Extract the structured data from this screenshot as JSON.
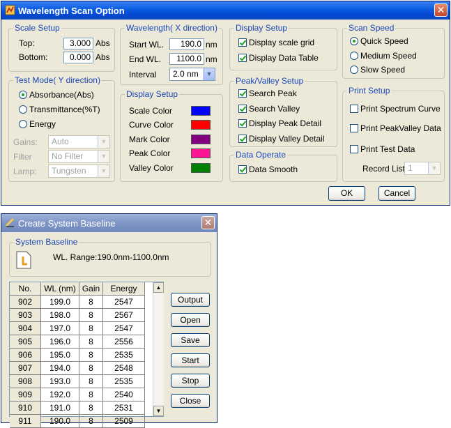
{
  "scan_window": {
    "title": "Wavelength Scan Option",
    "close_glyph": "✕",
    "scale_setup": {
      "legend": "Scale Setup",
      "top_label": "Top:",
      "top_value": "3.000",
      "top_unit": "Abs",
      "bottom_label": "Bottom:",
      "bottom_value": "0.000",
      "bottom_unit": "Abs"
    },
    "test_mode": {
      "legend": "Test Mode( Y direction)",
      "options": [
        "Absorbance(Abs)",
        "Transmittance(%T)",
        "Energy"
      ],
      "selected": "Absorbance(Abs)",
      "gains_label": "Gains:",
      "gains_value": "Auto",
      "filter_label": "Filter",
      "filter_value": "No Filter",
      "lamp_label": "Lamp:",
      "lamp_value": "Tungsten"
    },
    "wavelength": {
      "legend": "Wavelength( X direction)",
      "start_label": "Start WL.",
      "start_value": "190.0",
      "start_unit": "nm",
      "end_label": "End WL.",
      "end_value": "1100.0",
      "end_unit": "nm",
      "interval_label": "Interval",
      "interval_value": "2.0 nm"
    },
    "display_colors": {
      "legend": "Display Setup",
      "items": [
        {
          "label": "Scale Color",
          "color": "#0000ff"
        },
        {
          "label": "Curve Color",
          "color": "#ff0000"
        },
        {
          "label": "Mark Color",
          "color": "#800080"
        },
        {
          "label": "Peak Color",
          "color": "#ff1493"
        },
        {
          "label": "Valley Color",
          "color": "#008000"
        }
      ]
    },
    "display_setup": {
      "legend": "Display Setup",
      "scale_grid": "Display scale grid",
      "data_table": "Display Data Table"
    },
    "peak_valley": {
      "legend": "Peak/Valley Setup",
      "search_peak": "Search Peak",
      "search_valley": "Search Valley",
      "peak_detail": "Display Peak Detail",
      "valley_detail": "Display Valley Detail"
    },
    "data_operate": {
      "legend": "Data Operate",
      "smooth": "Data Smooth"
    },
    "scan_speed": {
      "legend": "Scan Speed",
      "options": [
        "Quick Speed",
        "Medium Speed",
        "Slow Speed"
      ],
      "selected": "Quick Speed"
    },
    "print_setup": {
      "legend": "Print Setup",
      "spectrum": "Print Spectrum Curve",
      "peakvalley": "Print PeakValley Data",
      "test_data": "Print Test Data",
      "record_list_label": "Record List",
      "record_list_value": "1"
    },
    "ok_label": "OK",
    "cancel_label": "Cancel"
  },
  "baseline_window": {
    "title": "Create System Baseline",
    "close_glyph": "✕",
    "group_legend": "System Baseline",
    "range_text": "WL. Range:190.0nm-1100.0nm",
    "columns": [
      "No.",
      "WL (nm)",
      "Gain",
      "Energy"
    ],
    "rows": [
      [
        "902",
        "199.0",
        "8",
        "2547"
      ],
      [
        "903",
        "198.0",
        "8",
        "2567"
      ],
      [
        "904",
        "197.0",
        "8",
        "2547"
      ],
      [
        "905",
        "196.0",
        "8",
        "2556"
      ],
      [
        "906",
        "195.0",
        "8",
        "2535"
      ],
      [
        "907",
        "194.0",
        "8",
        "2548"
      ],
      [
        "908",
        "193.0",
        "8",
        "2535"
      ],
      [
        "909",
        "192.0",
        "8",
        "2540"
      ],
      [
        "910",
        "191.0",
        "8",
        "2531"
      ],
      [
        "911",
        "190.0",
        "8",
        "2509"
      ]
    ],
    "buttons": [
      "Output",
      "Open",
      "Save",
      "Start",
      "Stop",
      "Close"
    ],
    "scroll_up": "▲",
    "scroll_down": "▼"
  }
}
